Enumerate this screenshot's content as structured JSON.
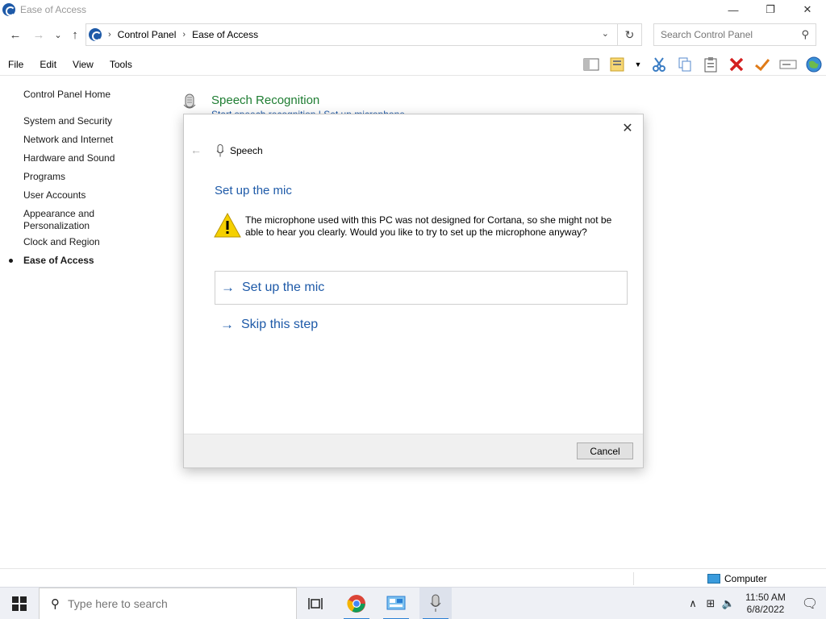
{
  "window": {
    "title": "Ease of Access",
    "minimize": "—",
    "restore": "❐",
    "close": "✕"
  },
  "nav": {
    "back": "←",
    "forward": "→",
    "recent": "⌄",
    "up": "↑",
    "crumbs": [
      "Control Panel",
      "Ease of Access"
    ],
    "crumb_sep": "›",
    "dropdown": "⌄",
    "refresh": "↻",
    "search_placeholder": "Search Control Panel",
    "search_icon": "⚲"
  },
  "menu": {
    "items": [
      "File",
      "Edit",
      "View",
      "Tools"
    ]
  },
  "toolbar": {
    "icons": [
      "layout-pane-icon",
      "properties-icon",
      "dropdown-icon",
      "cut-icon",
      "copy-icon",
      "paste-icon",
      "delete-icon",
      "check-icon",
      "rename-icon",
      "globe-icon"
    ]
  },
  "leftnav": {
    "home": "Control Panel Home",
    "items": [
      "System and Security",
      "Network and Internet",
      "Hardware and Sound",
      "Programs",
      "User Accounts",
      "Appearance and\nPersonalization",
      "Clock and Region",
      "Ease of Access"
    ]
  },
  "background": {
    "title": "Speech Recognition",
    "subtitle": "Start speech recognition   |   Set up microphone"
  },
  "dialog": {
    "close": "✕",
    "back": "←",
    "header": "Speech",
    "title": "Set up the mic",
    "warning": "The microphone used with this PC was not designed for Cortana, so she might not be able to hear you clearly. Would you like to try to set up the microphone anyway?",
    "options": [
      {
        "arrow": "→",
        "label": "Set up the mic"
      },
      {
        "arrow": "→",
        "label": "Skip this step"
      }
    ],
    "cancel": "Cancel"
  },
  "statusbar": {
    "location": "Computer"
  },
  "taskbar": {
    "search_placeholder": "Type here to search",
    "search_icon": "⚲",
    "tray_chevron": "∧",
    "tray_network": "⊞",
    "tray_volume": "🔈",
    "time": "11:50 AM",
    "date": "6/8/2022",
    "notifications": "🗨"
  },
  "colors": {
    "link": "#1e5aa8",
    "green_title": "#1e7d32",
    "accent": "#2a7fd4"
  }
}
